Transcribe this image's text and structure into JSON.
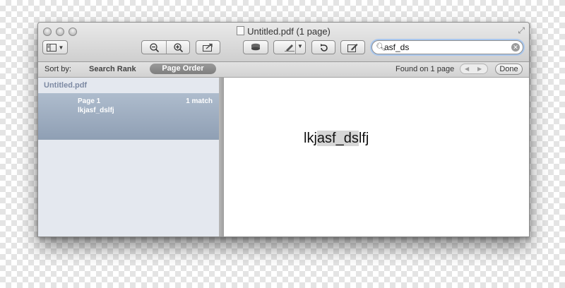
{
  "window": {
    "title": "Untitled.pdf (1 page)"
  },
  "toolbar": {
    "sidebar_icon": "sidebar-toggle-icon",
    "zoom_out_icon": "zoom-out-icon",
    "zoom_in_icon": "zoom-in-icon",
    "share_icon": "share-icon",
    "highlight_icon": "highlight-icon",
    "annotate_icon": "pen-icon",
    "rotate_icon": "rotate-icon",
    "edit_icon": "edit-icon"
  },
  "search": {
    "value": "asf_ds"
  },
  "findbar": {
    "sort_label": "Sort by:",
    "rank_label": "Search Rank",
    "order_label": "Page Order",
    "found_text": "Found on 1 page",
    "done_label": "Done"
  },
  "sidebar": {
    "filename": "Untitled.pdf",
    "results": [
      {
        "page": "Page 1",
        "matches": "1 match",
        "snippet": "lkjasf_dslfj"
      }
    ]
  },
  "document": {
    "text_before": "lkj",
    "text_match": "asf_ds",
    "text_after": "lfj"
  },
  "colors": {
    "search_focus": "#a9c7ee",
    "selected_result": "#9aaabf",
    "sidebar_bg": "#e4e8ef"
  }
}
